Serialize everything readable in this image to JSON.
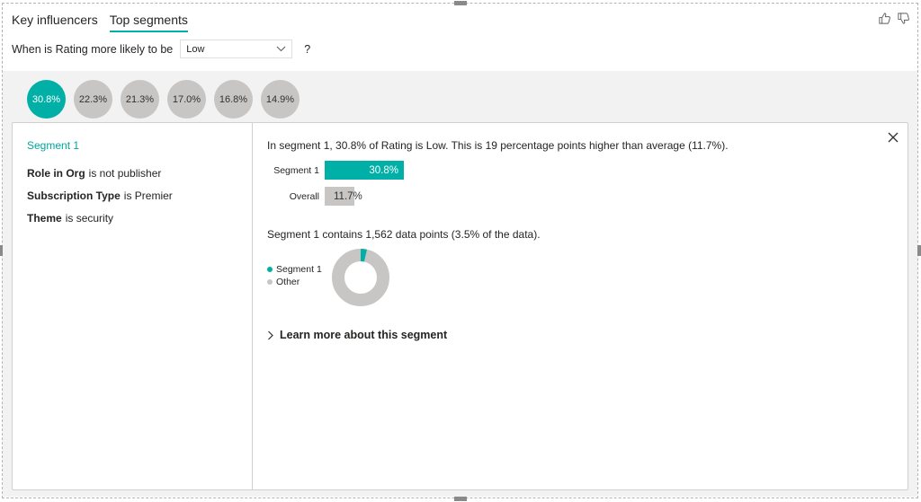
{
  "tabs": [
    {
      "label": "Key influencers",
      "active": false
    },
    {
      "label": "Top segments",
      "active": true
    }
  ],
  "question": {
    "prefix": "When is Rating more likely to be",
    "selected_value": "Low",
    "suffix": "?"
  },
  "segments": [
    {
      "label": "30.8%",
      "active": true
    },
    {
      "label": "22.3%",
      "active": false
    },
    {
      "label": "21.3%",
      "active": false
    },
    {
      "label": "17.0%",
      "active": false
    },
    {
      "label": "16.8%",
      "active": false
    },
    {
      "label": "14.9%",
      "active": false
    }
  ],
  "detail": {
    "title": "Segment 1",
    "conditions": [
      {
        "field": "Role in Org",
        "text": "is not publisher"
      },
      {
        "field": "Subscription Type",
        "text": "is Premier"
      },
      {
        "field": "Theme",
        "text": "is security"
      }
    ],
    "summary": "In segment 1, 30.8% of Rating is Low. This is 19 percentage points higher than average (11.7%).",
    "bars": [
      {
        "label": "Segment 1",
        "value": 30.8,
        "display": "30.8%"
      },
      {
        "label": "Overall",
        "value": 11.7,
        "display": "11.7%"
      }
    ],
    "contains_text": "Segment 1 contains 1,562 data points (3.5% of the data).",
    "donut": {
      "segment_share": 3.5,
      "legend": [
        {
          "label": "Segment 1",
          "color": "#00b0a6"
        },
        {
          "label": "Other",
          "color": "#c8c6c4"
        }
      ]
    },
    "learn_more": "Learn more about this segment"
  },
  "colors": {
    "accent": "#00b0a6",
    "grey": "#c8c6c4"
  }
}
